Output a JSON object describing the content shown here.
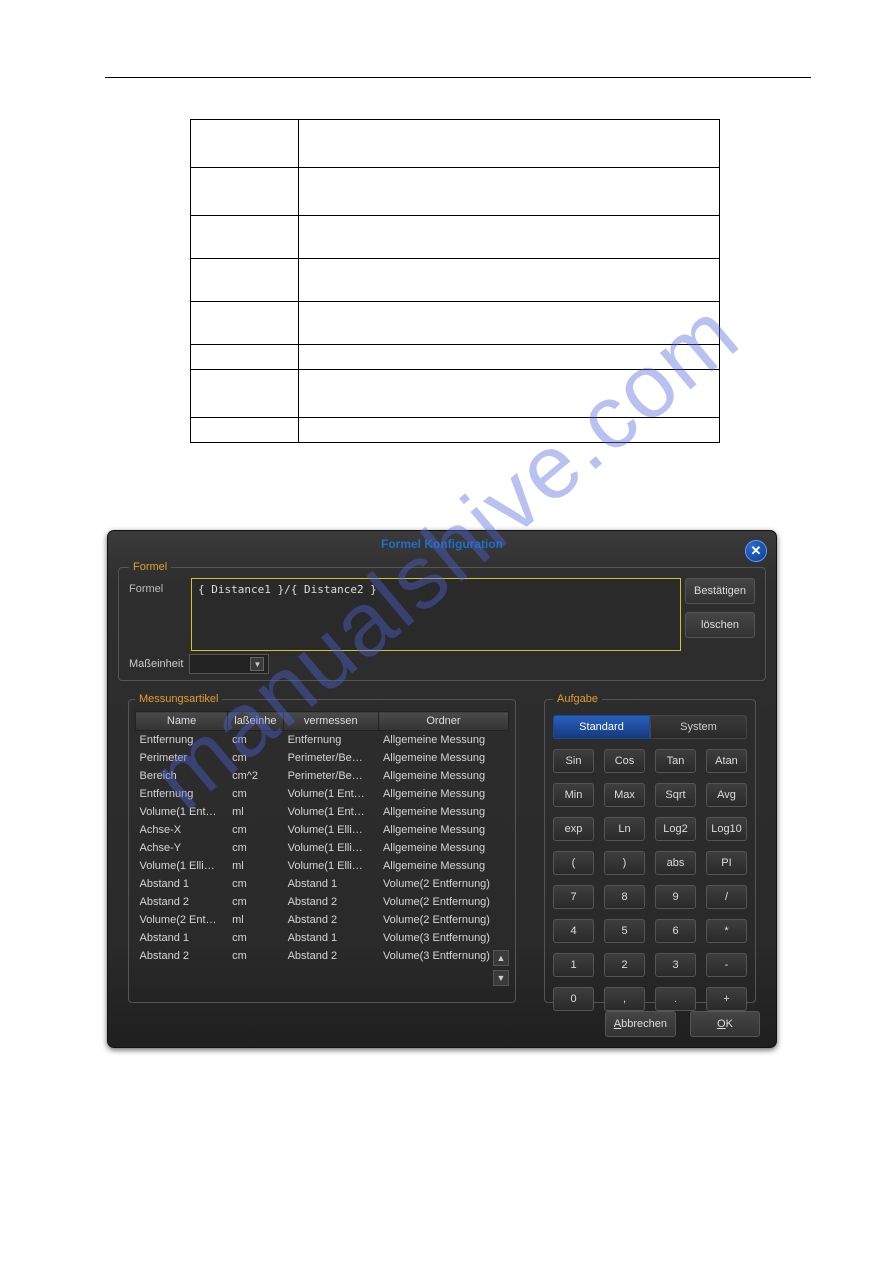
{
  "watermark": "manualshive.com",
  "def_table": {
    "rows": [
      {
        "c0": "",
        "c1": "",
        "class": "tall"
      },
      {
        "c0": "",
        "c1": "",
        "class": "tall"
      },
      {
        "c0": "",
        "c1": "",
        "class": ""
      },
      {
        "c0": "",
        "c1": "",
        "class": ""
      },
      {
        "c0": "",
        "c1": "",
        "class": ""
      },
      {
        "c0": "",
        "c1": "",
        "class": "short"
      },
      {
        "c0": "",
        "c1": "",
        "class": "tall"
      },
      {
        "c0": "",
        "c1": "",
        "class": "short"
      }
    ]
  },
  "dialog": {
    "title": "Formel Konfiguration",
    "close": "✕",
    "formel": {
      "legend": "Formel",
      "label": "Formel",
      "value": "{ Distance1 }/{ Distance2 }",
      "confirm": "Bestätigen",
      "clear": "löschen",
      "unit_label": "Maßeinheit",
      "unit_value": ""
    },
    "mess": {
      "legend": "Messungsartikel",
      "headers": [
        "Name",
        "laßeinhe",
        "vermessen",
        "Ordner"
      ],
      "rows": [
        [
          "Entfernung",
          "cm",
          "Entfernung",
          "Allgemeine Messung"
        ],
        [
          "Perimeter",
          "cm",
          "Perimeter/Be…",
          "Allgemeine Messung"
        ],
        [
          "Bereich",
          "cm^2",
          "Perimeter/Be…",
          "Allgemeine Messung"
        ],
        [
          "Entfernung",
          "cm",
          "Volume(1 Ent…",
          "Allgemeine Messung"
        ],
        [
          "Volume(1 Ent…",
          "ml",
          "Volume(1 Ent…",
          "Allgemeine Messung"
        ],
        [
          "Achse-X",
          "cm",
          "Volume(1 Elli…",
          "Allgemeine Messung"
        ],
        [
          "Achse-Y",
          "cm",
          "Volume(1 Elli…",
          "Allgemeine Messung"
        ],
        [
          "Volume(1 Elli…",
          "ml",
          "Volume(1 Elli…",
          "Allgemeine Messung"
        ],
        [
          "Abstand 1",
          "cm",
          "Abstand 1",
          "Volume(2 Entfernung)"
        ],
        [
          "Abstand 2",
          "cm",
          "Abstand 2",
          "Volume(2 Entfernung)"
        ],
        [
          "Volume(2 Ent…",
          "ml",
          "Abstand 2",
          "Volume(2 Entfernung)"
        ],
        [
          "Abstand 1",
          "cm",
          "Abstand 1",
          "Volume(3 Entfernung)"
        ],
        [
          "Abstand 2",
          "cm",
          "Abstand 2",
          "Volume(3 Entfernung)"
        ]
      ]
    },
    "aufgabe": {
      "legend": "Aufgabe",
      "tabs": {
        "standard": "Standard",
        "system": "System"
      },
      "keys": [
        "Sin",
        "Cos",
        "Tan",
        "Atan",
        "Min",
        "Max",
        "Sqrt",
        "Avg",
        "exp",
        "Ln",
        "Log2",
        "Log10",
        "(",
        ")",
        "abs",
        "PI",
        "7",
        "8",
        "9",
        "/",
        "4",
        "5",
        "6",
        "*",
        "1",
        "2",
        "3",
        "-",
        "0",
        ",",
        ".",
        "+"
      ]
    },
    "footer": {
      "cancel": "Abbrechen",
      "ok": "OK",
      "cancel_ul": "A",
      "ok_ul": "O"
    }
  }
}
